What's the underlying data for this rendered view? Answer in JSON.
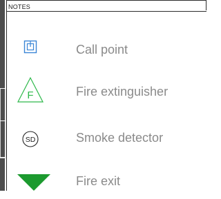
{
  "legend": {
    "title": "NOTES",
    "items": [
      {
        "label": "Call point",
        "icon": "call-point-icon",
        "color": "#3a86d6"
      },
      {
        "label": "Fire extinguisher",
        "icon": "fire-extinguisher-icon",
        "color": "#2db84a",
        "glyph": "F"
      },
      {
        "label": "Smoke detector",
        "icon": "smoke-detector-icon",
        "color": "#222222",
        "glyph": "SD"
      },
      {
        "label": "Fire exit",
        "icon": "fire-exit-icon",
        "color": "#1c9a2f"
      }
    ]
  }
}
